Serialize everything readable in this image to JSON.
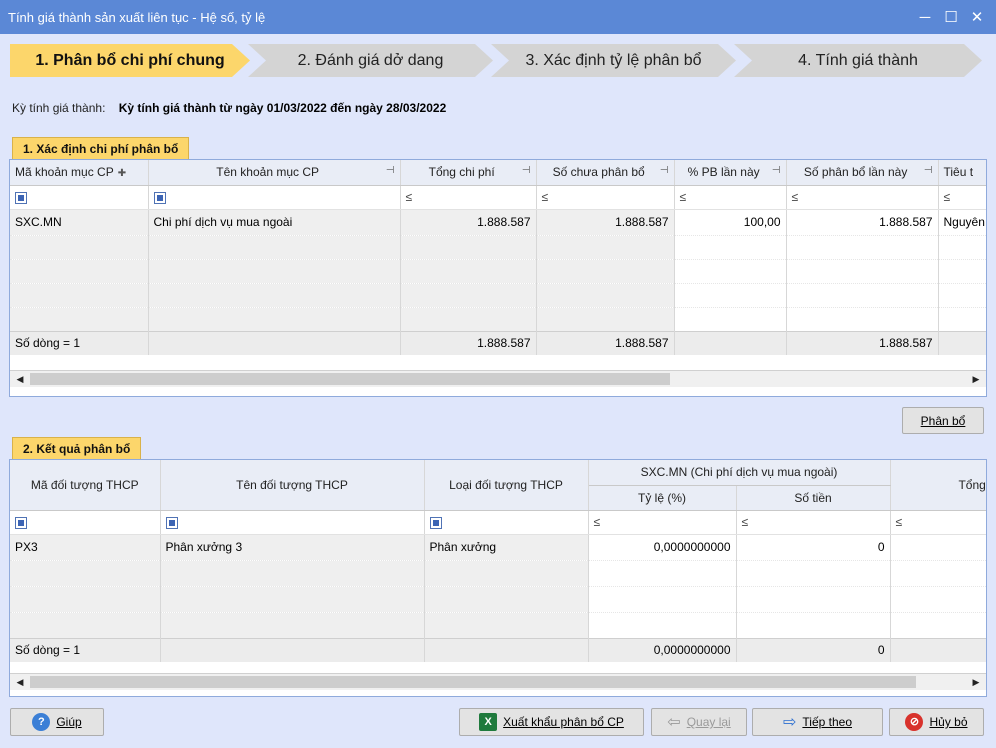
{
  "window": {
    "title": "Tính giá thành sản xuất liên tục - Hệ số, tỷ lệ",
    "minimize": "─",
    "maximize": "☐",
    "close": "✕"
  },
  "steps": [
    {
      "label": "1. Phân bổ chi phí chung"
    },
    {
      "label": "2. Đánh giá dở dang"
    },
    {
      "label": "3. Xác định tỷ lệ phân bổ"
    },
    {
      "label": "4. Tính giá thành"
    }
  ],
  "period": {
    "label": "Kỳ tính giá thành:",
    "value": "Kỳ tính giá thành từ ngày 01/03/2022 đến ngày 28/03/2022"
  },
  "section1": {
    "title": "1. Xác định chi phí phân bổ",
    "columns": [
      "Mã khoản mục CP",
      "Tên khoản mục CP",
      "Tổng chi phí",
      "Số chưa phân bổ",
      "% PB lần này",
      "Số phân bổ lần này",
      "Tiêu t"
    ],
    "filter_le": "≤",
    "row": {
      "ma": "SXC.MN",
      "ten": "Chi phí dịch vụ mua ngoài",
      "tong": "1.888.587",
      "chua": "1.888.587",
      "pb": "100,00",
      "so_pb": "1.888.587",
      "tieu": "Nguyên"
    },
    "total": {
      "label": "Số dòng = 1",
      "tong": "1.888.587",
      "chua": "1.888.587",
      "so_pb": "1.888.587"
    }
  },
  "phanbo_button": "Phân bổ",
  "section2": {
    "title": "2. Kết quả phân bổ",
    "columns": {
      "ma": "Mã đối tượng THCP",
      "ten": "Tên đối tượng THCP",
      "loai": "Loại đối tượng THCP",
      "group": "SXC.MN (Chi phí dịch vụ mua ngoài)",
      "tyle": "Tỷ lệ (%)",
      "sotien": "Số tiền",
      "tong": "Tổng chi p"
    },
    "filter_le": "≤",
    "row": {
      "ma": "PX3",
      "ten": "Phân xưởng 3",
      "loai": "Phân xưởng",
      "tyle": "0,0000000000",
      "sotien": "0"
    },
    "total": {
      "label": "Số dòng = 1",
      "tyle": "0,0000000000",
      "sotien": "0"
    }
  },
  "footer": {
    "help": "Giúp",
    "export": "Xuất khẩu phân bổ CP",
    "back": "Quay lại",
    "next": "Tiếp theo",
    "cancel": "Hủy bỏ"
  },
  "colors": {
    "accent": "#fcd66b",
    "titlebar": "#5b88d6",
    "background": "#dfe6fb"
  }
}
